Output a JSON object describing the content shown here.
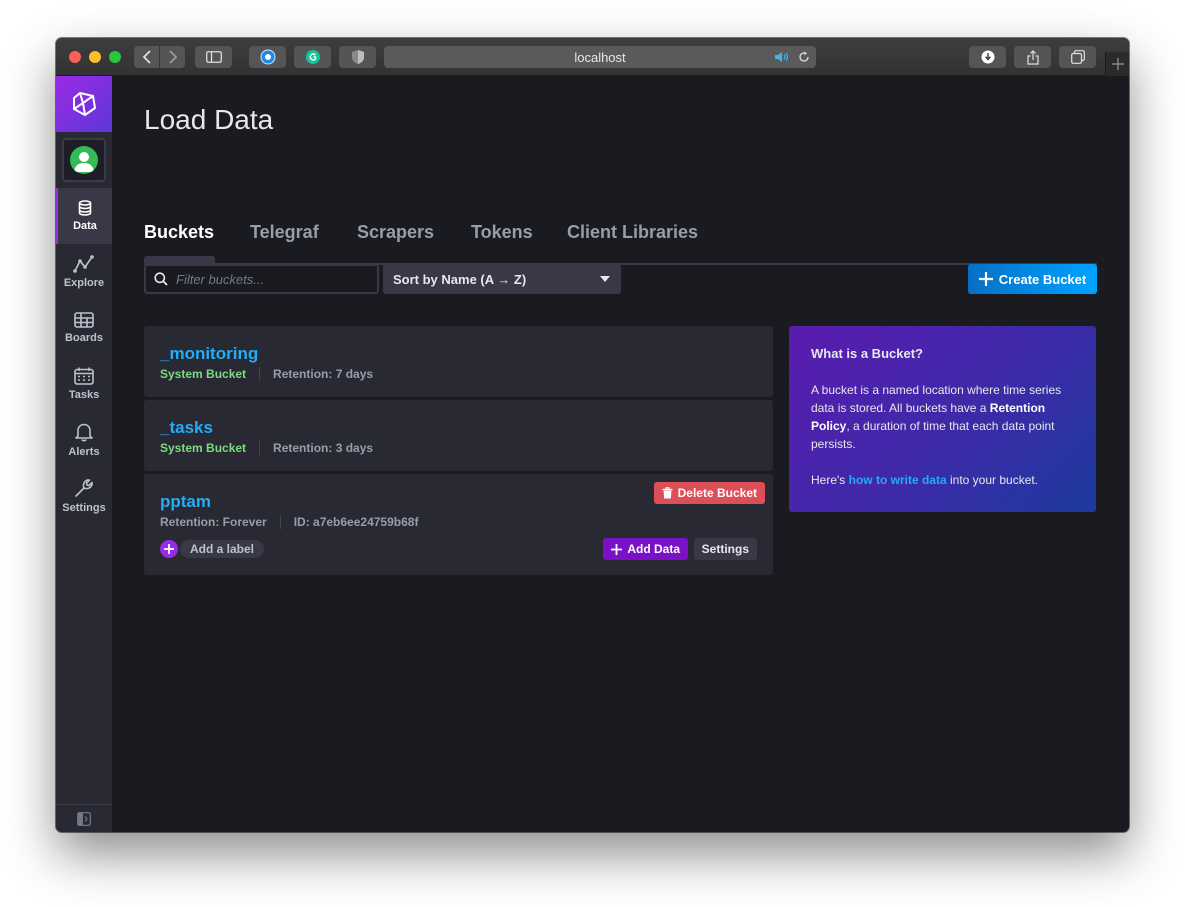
{
  "browser": {
    "url": "localhost",
    "colors": {
      "close": "#fd5f57",
      "minimize": "#febc2e",
      "maximize": "#27c840"
    }
  },
  "sidebar": {
    "items": [
      {
        "id": "data",
        "label": "Data",
        "icon": "database-icon",
        "active": true
      },
      {
        "id": "explore",
        "label": "Explore",
        "icon": "graph-icon",
        "active": false
      },
      {
        "id": "boards",
        "label": "Boards",
        "icon": "dashboard-icon",
        "active": false
      },
      {
        "id": "tasks",
        "label": "Tasks",
        "icon": "calendar-icon",
        "active": false
      },
      {
        "id": "alerts",
        "label": "Alerts",
        "icon": "bell-icon",
        "active": false
      },
      {
        "id": "settings",
        "label": "Settings",
        "icon": "wrench-icon",
        "active": false
      }
    ]
  },
  "page": {
    "title": "Load Data",
    "tabs": [
      {
        "label": "Buckets",
        "active": true
      },
      {
        "label": "Telegraf",
        "active": false
      },
      {
        "label": "Scrapers",
        "active": false
      },
      {
        "label": "Tokens",
        "active": false
      },
      {
        "label": "Client Libraries",
        "active": false
      }
    ]
  },
  "toolbar": {
    "search_placeholder": "Filter buckets...",
    "sort_label": "Sort by Name (A → Z)",
    "create_label": "Create Bucket"
  },
  "buckets": [
    {
      "name": "_monitoring",
      "type": "System Bucket",
      "retention": "Retention: 7 days"
    },
    {
      "name": "_tasks",
      "type": "System Bucket",
      "retention": "Retention: 3 days"
    },
    {
      "name": "pptam",
      "retention": "Retention: Forever",
      "id": "ID: a7eb6ee24759b68f",
      "delete_label": "Delete Bucket",
      "add_label": "Add a label",
      "add_data_label": "Add Data",
      "settings_label": "Settings"
    }
  ],
  "info": {
    "title": "What is a Bucket?",
    "p1_a": "A bucket is a named location where time series data is stored. All buckets have a ",
    "p1_b": "Retention Policy",
    "p1_c": ", a duration of time that each data point persists.",
    "p2_a": "Here's ",
    "p2_link": "how to write data",
    "p2_b": " into your bucket."
  }
}
